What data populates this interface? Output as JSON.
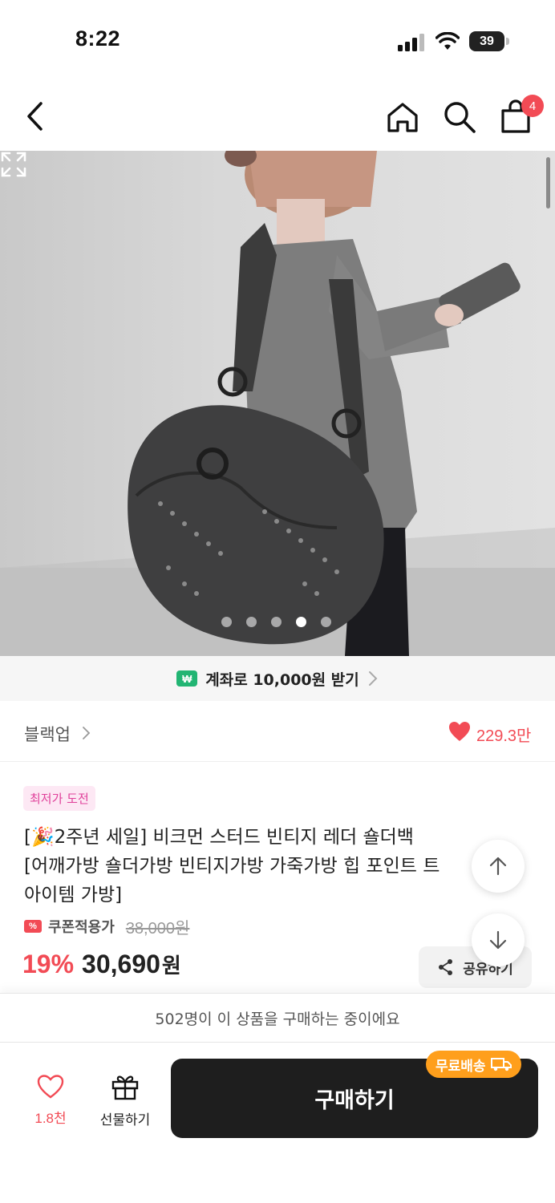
{
  "status_bar": {
    "time": "8:22",
    "battery": "39"
  },
  "nav": {
    "cart_count": "4"
  },
  "hero": {
    "image_count": 5,
    "active_index": 3
  },
  "promo": {
    "badge": "₩",
    "text": "계좌로 10,000원 받기"
  },
  "brand": {
    "name": "블랙업",
    "like_count": "229.3만"
  },
  "product": {
    "tag": "최저가 도전",
    "title": "[🎉2주년 세일] 비크먼 스터드 빈티지 레더 숄더백\n[어깨가방 숄더가방 빈티지가방 가죽가방 힙 포인트 트\n아이템 가방]",
    "coupon_label": "쿠폰적용가",
    "original_price": "38,000원",
    "discount": "19%",
    "price": "30,690",
    "price_unit": "원"
  },
  "share": {
    "label": "공유하기"
  },
  "notice": {
    "text": "502명이 이 상품을 구매하는 중이에요"
  },
  "bottom": {
    "wish_count": "1.8천",
    "gift_label": "선물하기",
    "buy_label": "구매하기",
    "free_shipping": "무료배송"
  },
  "colors": {
    "accent": "#f24b55",
    "buy_button": "#1e1e1e",
    "free_ship": "#ff9f1c",
    "tag_text": "#e0409a"
  }
}
